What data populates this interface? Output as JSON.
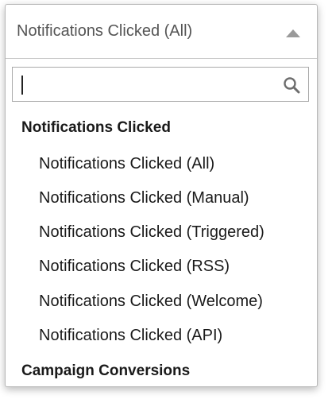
{
  "select": {
    "selected_label": "Notifications Clicked (All)",
    "search_value": "",
    "icon_caret": "caret-up-icon",
    "icon_search": "search-icon"
  },
  "groups": [
    {
      "label": "Notifications Clicked",
      "options": [
        "Notifications Clicked (All)",
        "Notifications Clicked (Manual)",
        "Notifications Clicked (Triggered)",
        "Notifications Clicked (RSS)",
        "Notifications Clicked (Welcome)",
        "Notifications Clicked (API)"
      ]
    },
    {
      "label": "Campaign Conversions",
      "options": []
    }
  ]
}
